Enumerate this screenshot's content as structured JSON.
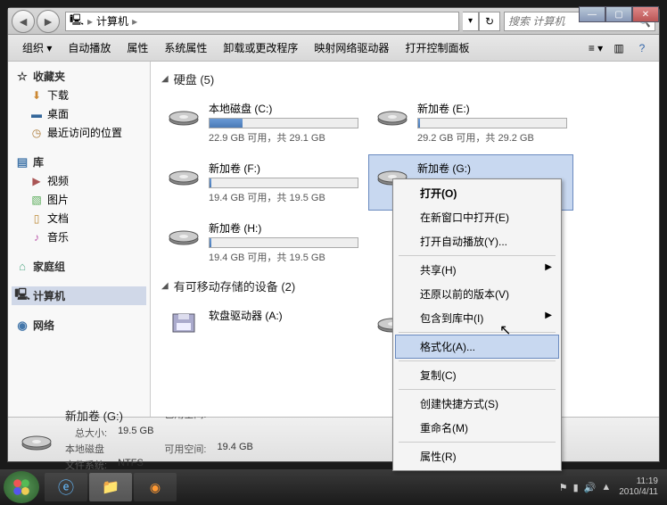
{
  "window": {
    "breadcrumb_root": "计算机",
    "search_placeholder": "搜索 计算机",
    "buttons": {
      "min": "—",
      "max": "▢",
      "close": "✕"
    }
  },
  "toolbar": {
    "organize": "组织 ▾",
    "autoplay": "自动播放",
    "properties": "属性",
    "system_props": "系统属性",
    "uninstall": "卸载或更改程序",
    "map_drive": "映射网络驱动器",
    "control_panel": "打开控制面板"
  },
  "sidebar": {
    "favorites": {
      "head": "收藏夹",
      "items": [
        "下载",
        "桌面",
        "最近访问的位置"
      ]
    },
    "libraries": {
      "head": "库",
      "items": [
        "视频",
        "图片",
        "文档",
        "音乐"
      ]
    },
    "homegroup": "家庭组",
    "computer": "计算机",
    "network": "网络"
  },
  "sections": {
    "hdd": "硬盘 (5)",
    "removable": "有可移动存储的设备 (2)"
  },
  "drives": [
    {
      "name": "本地磁盘 (C:)",
      "text": "22.9 GB 可用，共 29.1 GB",
      "fill": 22
    },
    {
      "name": "新加卷 (E:)",
      "text": "29.2 GB 可用，共 29.2 GB",
      "fill": 1
    },
    {
      "name": "新加卷 (F:)",
      "text": "19.4 GB 可用，共 19.5 GB",
      "fill": 1
    },
    {
      "name": "新加卷 (G:)",
      "text": "",
      "fill": 0,
      "selected": true,
      "nobar": true
    },
    {
      "name": "新加卷 (H:)",
      "text": "19.4 GB 可用，共 19.5 GB",
      "fill": 1
    }
  ],
  "removable": [
    {
      "name": "软盘驱动器 (A:)"
    }
  ],
  "context_menu": [
    {
      "label": "打开(O)",
      "bold": true
    },
    {
      "label": "在新窗口中打开(E)"
    },
    {
      "label": "打开自动播放(Y)..."
    },
    {
      "sep": true
    },
    {
      "label": "共享(H)",
      "sub": true
    },
    {
      "label": "还原以前的版本(V)"
    },
    {
      "label": "包含到库中(I)",
      "sub": true
    },
    {
      "sep": true
    },
    {
      "label": "格式化(A)...",
      "hover": true
    },
    {
      "sep": true
    },
    {
      "label": "复制(C)"
    },
    {
      "sep": true
    },
    {
      "label": "创建快捷方式(S)"
    },
    {
      "label": "重命名(M)"
    },
    {
      "sep": true
    },
    {
      "label": "属性(R)"
    }
  ],
  "statusbar": {
    "name": "新加卷 (G:)",
    "type": "本地磁盘",
    "used_lbl": "已用空间:",
    "used_val": "",
    "free_lbl": "可用空间:",
    "free_val": "19.4 GB",
    "total_lbl": "总大小:",
    "total_val": "19.5 GB",
    "fs_lbl": "文件系统:",
    "fs_val": "NTFS"
  },
  "taskbar": {
    "time": "11:19",
    "date": "2010/4/11"
  }
}
